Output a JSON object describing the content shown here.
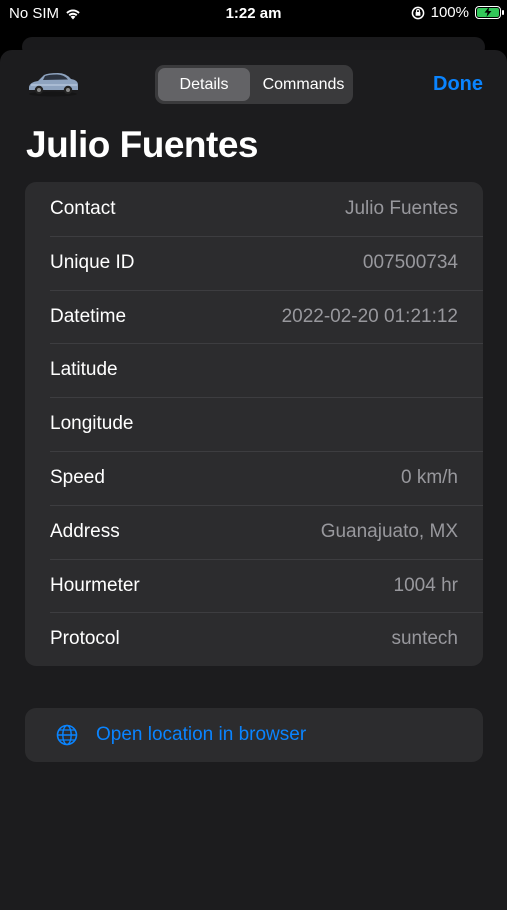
{
  "status_bar": {
    "carrier": "No SIM",
    "time": "1:22 am",
    "battery_percent": "100%",
    "battery_level": 1.0,
    "battery_color": "#33c759",
    "icons": [
      "wifi-icon",
      "orientation-lock-icon",
      "battery-charging-icon"
    ]
  },
  "header": {
    "segments": [
      "Details",
      "Commands"
    ],
    "selected_segment": "Details",
    "done_label": "Done",
    "icon": "car-icon"
  },
  "title": "Julio Fuentes",
  "details": [
    {
      "label": "Contact",
      "value": "Julio Fuentes"
    },
    {
      "label": "Unique ID",
      "value": "007500734"
    },
    {
      "label": "Datetime",
      "value": "2022-02-20 01:21:12"
    },
    {
      "label": "Latitude",
      "value": ""
    },
    {
      "label": "Longitude",
      "value": ""
    },
    {
      "label": "Speed",
      "value": "0 km/h"
    },
    {
      "label": "Address",
      "value": "Guanajuato, MX"
    },
    {
      "label": "Hourmeter",
      "value": "1004 hr"
    },
    {
      "label": "Protocol",
      "value": "suntech"
    }
  ],
  "action": {
    "label": "Open location in browser",
    "icon": "globe-icon"
  },
  "colors": {
    "accent": "#0a84ff",
    "sheet_background": "#1c1c1e",
    "card_background": "#2c2c2e",
    "secondary_text": "#98989d"
  }
}
